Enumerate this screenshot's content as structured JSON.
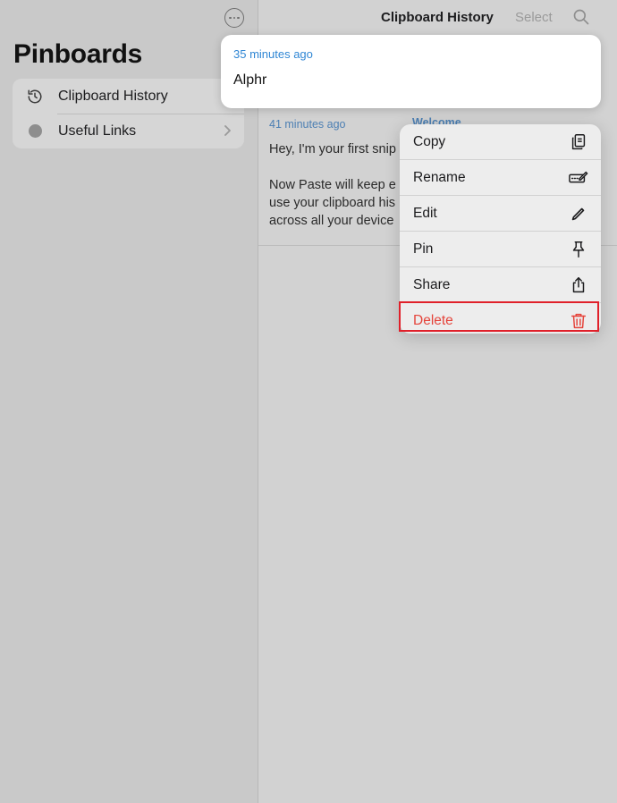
{
  "sidebar": {
    "title": "Pinboards",
    "items": [
      {
        "label": "Clipboard History",
        "icon": "history-icon"
      },
      {
        "label": "Useful Links",
        "icon": "gray-dot-icon"
      }
    ]
  },
  "navbar": {
    "title": "Clipboard History",
    "select_label": "Select"
  },
  "popup": {
    "time": "35 minutes ago",
    "text": "Alphr"
  },
  "snippet": {
    "time": "41 minutes ago",
    "tag": "Welcome",
    "text": "Hey, I'm your first snip\n\nNow Paste will keep e\nuse your clipboard his\nacross all your device"
  },
  "context_menu": {
    "items": [
      {
        "label": "Copy",
        "icon": "copy-icon"
      },
      {
        "label": "Rename",
        "icon": "rename-icon"
      },
      {
        "label": "Edit",
        "icon": "pencil-icon"
      },
      {
        "label": "Pin",
        "icon": "pin-icon"
      },
      {
        "label": "Share",
        "icon": "share-icon"
      },
      {
        "label": "Delete",
        "icon": "trash-icon",
        "danger": true
      }
    ]
  },
  "colors": {
    "accent_blue": "#2f86d4",
    "danger_red": "#e5443b",
    "highlight_red": "#e0202a"
  }
}
